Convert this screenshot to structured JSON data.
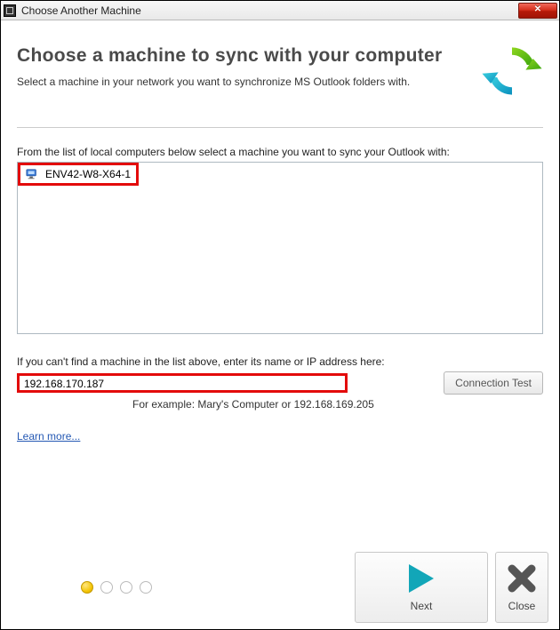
{
  "window": {
    "title": "Choose Another Machine"
  },
  "header": {
    "heading": "Choose a machine to sync with your computer",
    "subtitle": "Select a machine in your network you want to synchronize MS Outlook folders with."
  },
  "list": {
    "label": "From the list of local computers below select a machine you want to sync your Outlook with:",
    "items": [
      {
        "name": "ENV42-W8-X64-1"
      }
    ]
  },
  "ip": {
    "label": "If you can't find a machine in the list above, enter its name or IP address here:",
    "value": "192.168.170.187",
    "example": "For example: Mary's Computer or 192.168.169.205",
    "test_button": "Connection Test"
  },
  "learn_more": "Learn more...",
  "footer": {
    "next": "Next",
    "close": "Close"
  }
}
